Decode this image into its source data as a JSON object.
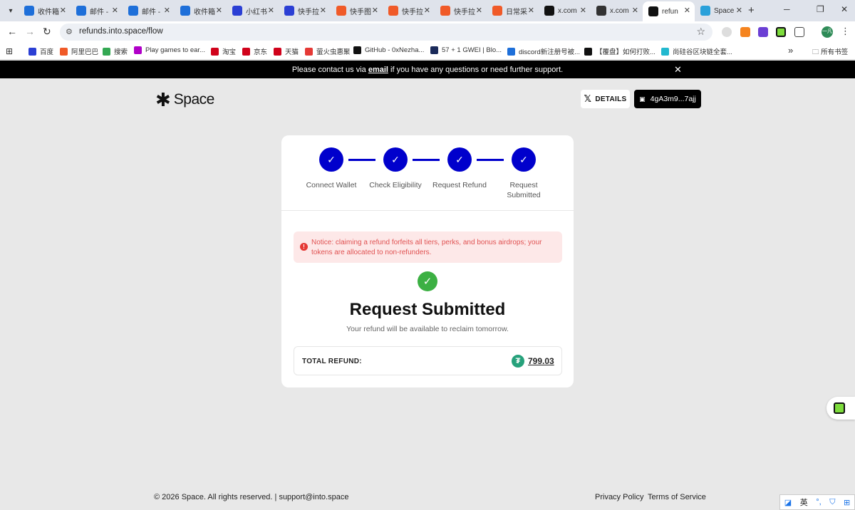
{
  "browser": {
    "tabs": [
      {
        "title": "收件箱",
        "color": "#1e6fd9"
      },
      {
        "title": "邮件 -",
        "color": "#1e6fd9"
      },
      {
        "title": "邮件 -",
        "color": "#1e6fd9"
      },
      {
        "title": "收件箱",
        "color": "#1e6fd9"
      },
      {
        "title": "小红书",
        "color": "#2b3fd4"
      },
      {
        "title": "快手拉",
        "color": "#2b3fd4"
      },
      {
        "title": "快手图",
        "color": "#f05a28"
      },
      {
        "title": "快手拉",
        "color": "#f05a28"
      },
      {
        "title": "快手拉",
        "color": "#f05a28"
      },
      {
        "title": "日常采",
        "color": "#f05a28"
      },
      {
        "title": "x.com",
        "color": "#111111"
      },
      {
        "title": "x.com",
        "color": "#333333"
      },
      {
        "title": "refun",
        "color": "#111111"
      },
      {
        "title": "Space",
        "color": "#2aa1da"
      }
    ],
    "url": "refunds.into.space/flow",
    "bookmarks": [
      {
        "label": "百度",
        "color": "#2b3fd4"
      },
      {
        "label": "阿里巴巴",
        "color": "#f05a28"
      },
      {
        "label": "搜索",
        "color": "#34a853"
      },
      {
        "label": "Play games to ear...",
        "color": "#b000c8"
      },
      {
        "label": "淘宝",
        "color": "#d0021b"
      },
      {
        "label": "京东",
        "color": "#d0021b"
      },
      {
        "label": "天猫",
        "color": "#d0021b"
      },
      {
        "label": "萤火虫惠聚",
        "color": "#e53935"
      },
      {
        "label": "GitHub - 0xNezha...",
        "color": "#111111"
      },
      {
        "label": "57 + 1 GWEI | Blo...",
        "color": "#1a2a5a"
      },
      {
        "label": "discord新注册号被...",
        "color": "#1e6fd9"
      },
      {
        "label": "【覆盘】如何打败...",
        "color": "#111111"
      },
      {
        "label": "尚硅谷区块链全套...",
        "color": "#22b8cf"
      }
    ],
    "bookmarks_folder": "所有书签"
  },
  "notice_bar": {
    "before": "Please contact us via ",
    "link": "email",
    "after": " if you have any questions or need further support."
  },
  "header": {
    "logo_text": "Space",
    "details_label": "DETAILS",
    "wallet_label": "4gA3m9...7ajj"
  },
  "steps": [
    {
      "label": "Connect Wallet"
    },
    {
      "label": "Check Eligibility"
    },
    {
      "label": "Request Refund"
    },
    {
      "label": "Request Submitted"
    }
  ],
  "notice": "Notice: claiming a refund forfeits all tiers, perks, and bonus airdrops; your tokens are allocated to non-refunders.",
  "result": {
    "title": "Request Submitted",
    "subtitle": "Your refund will be available to reclaim tomorrow."
  },
  "total": {
    "label": "TOTAL REFUND:",
    "value": "799.03"
  },
  "footer": {
    "copyright": "© 2026 Space. All rights reserved. | support@into.space",
    "privacy": "Privacy Policy",
    "terms": "Terms of Service"
  },
  "ime": {
    "lang": "英"
  }
}
